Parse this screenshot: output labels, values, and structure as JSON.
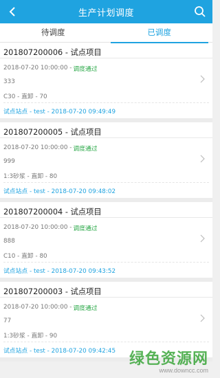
{
  "header": {
    "title": "生产计划调度"
  },
  "tabs": [
    {
      "label": "待调度",
      "active": false
    },
    {
      "label": "已调度",
      "active": true
    }
  ],
  "cards": [
    {
      "title": "201807200006 - 试点项目",
      "datetime": "2018-07-20 10:00:00 -",
      "status": "调度通过",
      "quantity": "333",
      "spec": "C30 - 直卸 - 70",
      "footer": "试点站点 - test - 2018-07-20 09:49:49"
    },
    {
      "title": "201807200005 - 试点项目",
      "datetime": "2018-07-20 10:00:00 -",
      "status": "调度通过",
      "quantity": "999",
      "spec": "1:3砂浆 - 直卸 - 80",
      "footer": "试点站点 - test - 2018-07-20 09:48:02"
    },
    {
      "title": "201807200004 - 试点项目",
      "datetime": "2018-07-20 10:00:00 -",
      "status": "调度通过",
      "quantity": "888",
      "spec": "C10 - 直卸 - 80",
      "footer": "试点站点 - test - 2018-07-20 09:43:52"
    },
    {
      "title": "201807200003 - 试点项目",
      "datetime": "2018-07-20 10:00:00 -",
      "status": "调度通过",
      "quantity": "77",
      "spec": "1:3砂浆 - 直卸 - 90",
      "footer": "试点站点 - test - 2018-07-20 09:42:45"
    }
  ],
  "watermark": {
    "main": "绿色资源网",
    "sub": "www.downcc.com"
  },
  "colors": {
    "accent": "#1fa3e0",
    "status": "#27a745"
  }
}
